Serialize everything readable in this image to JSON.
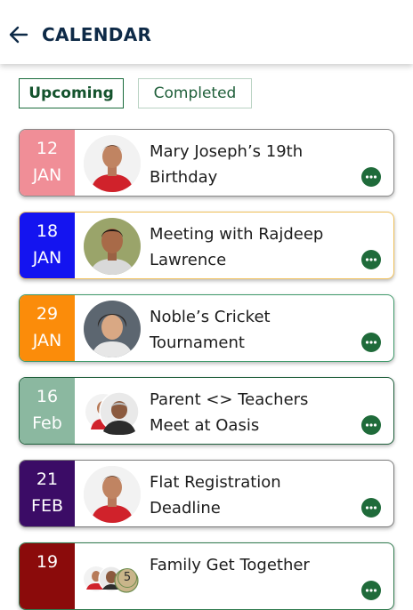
{
  "header": {
    "title": "CALENDAR",
    "back_icon": "arrow-left-icon"
  },
  "tabs": [
    {
      "label": "Upcoming",
      "active": true
    },
    {
      "label": "Completed",
      "active": false
    }
  ],
  "events": [
    {
      "day": "12",
      "month": "JAN",
      "title_line1": "Mary Joseph’s 19th",
      "title_line2": "Birthday",
      "date_color": "#f08e97",
      "border_color": "#8a8a8a"
    },
    {
      "day": "18",
      "month": "JAN",
      "title_line1": "Meeting with Rajdeep",
      "title_line2": "Lawrence",
      "date_color": "#1414f0",
      "border_color": "#f0c05a"
    },
    {
      "day": "29",
      "month": "JAN",
      "title_line1": "Noble’s Cricket",
      "title_line2": "Tournament",
      "date_color": "#fb8c0a",
      "border_color": "#3f9a6a"
    },
    {
      "day": "16",
      "month": "Feb",
      "title_line1": "Parent <> Teachers",
      "title_line2": "Meet at Oasis",
      "date_color": "#8bb8a0",
      "border_color": "#1d5e3a"
    },
    {
      "day": "21",
      "month": "FEB",
      "title_line1": "Flat Registration",
      "title_line2": "Deadline",
      "date_color": "#3b0c66",
      "border_color": "#7c7c7c"
    },
    {
      "day": "19",
      "month": "",
      "title_line1": "Family Get Together",
      "title_line2": "",
      "date_color": "#8b0b0b",
      "border_color": "#2f7b4e",
      "avatar_count": "5"
    }
  ],
  "more_icon": "more-horizontal-icon"
}
